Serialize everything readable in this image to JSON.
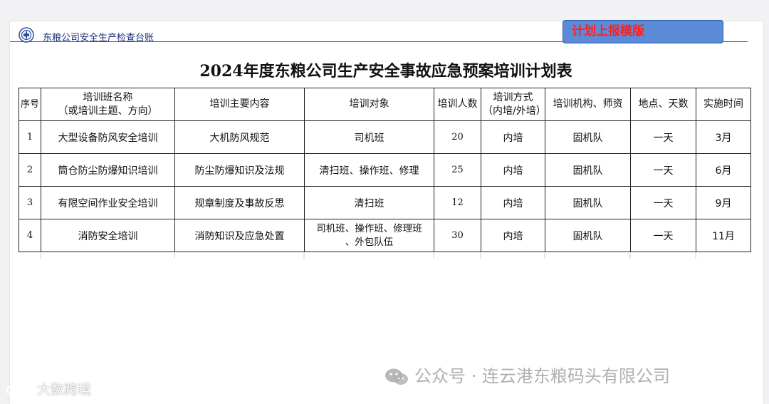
{
  "header": {
    "company_title": "东粮公司安全生产检查台账",
    "badge_label": "计划上报模版"
  },
  "document": {
    "title": "2024年度东粮公司生产安全事故应急预案培训计划表"
  },
  "table": {
    "columns": [
      "序号",
      "培训班名称\n（或培训主题、方向）",
      "培训主要内容",
      "培训对象",
      "培训人数",
      "培训方式\n（内培/外培）",
      "培训机构、师资",
      "地点、天数",
      "实施时间"
    ],
    "rows": [
      [
        "1",
        "大型设备防风安全培训",
        "大机防风规范",
        "司机班",
        "20",
        "内培",
        "固机队",
        "一天",
        "3月"
      ],
      [
        "2",
        "筒仓防尘防爆知识培训",
        "防尘防爆知识及法规",
        "清扫班、操作班、修理",
        "25",
        "内培",
        "固机队",
        "一天",
        "6月"
      ],
      [
        "3",
        "有限空间作业安全培训",
        "规章制度及事故反思",
        "清扫班",
        "12",
        "内培",
        "固机队",
        "一天",
        "9月"
      ],
      [
        "4",
        "消防安全培训",
        "消防知识及应急处置",
        "司机班、操作班、修理班\n、外包队伍",
        "30",
        "内培",
        "固机队",
        "一天",
        "11月"
      ]
    ]
  },
  "watermark": {
    "text": "公众号 · 连云港东粮码头有限公司",
    "corner_text": "大数跨境",
    "icon": "wechat-icon"
  },
  "colors": {
    "badge_bg": "#5b8bd6",
    "badge_text": "#ff1f1f",
    "header_text": "#1b2c7a",
    "rule": "#2b5fb0"
  }
}
